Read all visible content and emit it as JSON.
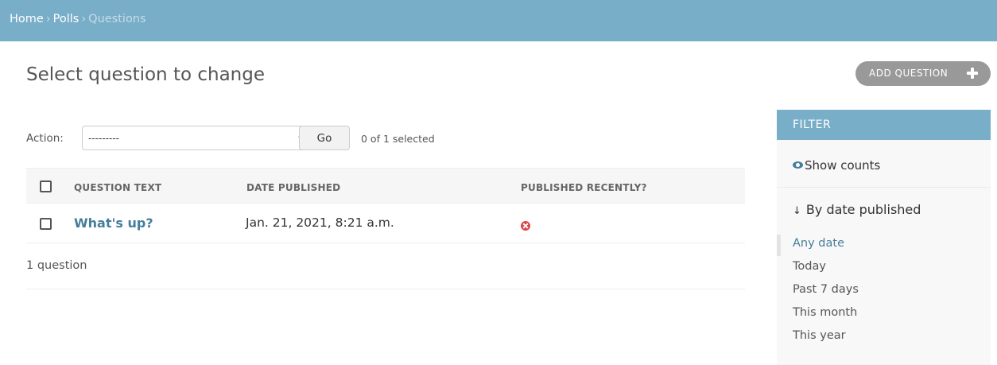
{
  "breadcrumbs": {
    "home": "Home",
    "polls": "Polls",
    "current": "Questions",
    "separator": "›"
  },
  "page_title": "Select question to change",
  "add_button": {
    "label": "ADD QUESTION"
  },
  "actions": {
    "label": "Action:",
    "selected": "---------",
    "go": "Go",
    "count": "0 of 1 selected"
  },
  "table": {
    "headers": [
      "QUESTION TEXT",
      "DATE PUBLISHED",
      "PUBLISHED RECENTLY?"
    ],
    "rows": [
      {
        "question": "What's up?",
        "date": "Jan. 21, 2021, 8:21 a.m.",
        "published_recently": "false"
      }
    ],
    "paginator": "1 question"
  },
  "filter": {
    "title": "FILTER",
    "show_counts": "Show counts",
    "section_arrow": "↓",
    "section": "By date published",
    "options": [
      "Any date",
      "Today",
      "Past 7 days",
      "This month",
      "This year"
    ],
    "selected_option": "Any date"
  },
  "colors": {
    "header": "#79aec8",
    "link": "#447e9b",
    "false_icon": "#dd4646",
    "add_button": "#999999"
  },
  "icons": {
    "add": "plus-icon",
    "dropdown": "chevron-down-icon",
    "false": "x-circle-icon",
    "show_counts": "eye-icon"
  }
}
